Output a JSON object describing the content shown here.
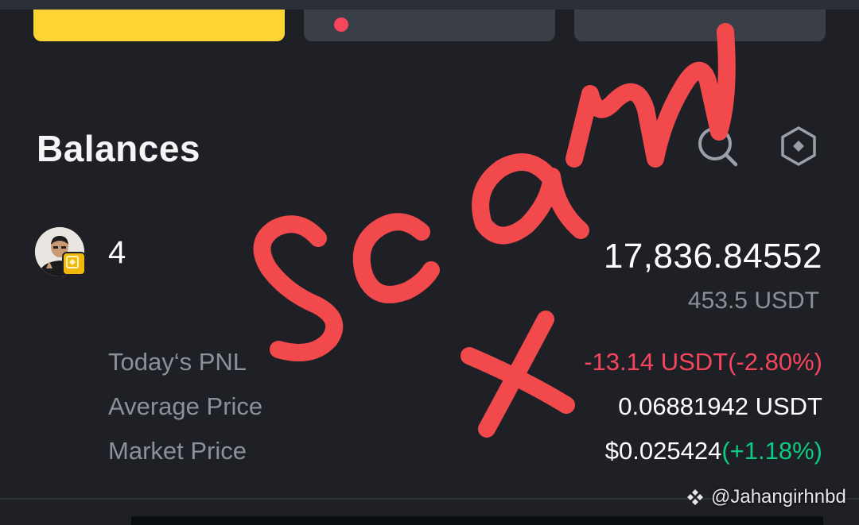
{
  "balances": {
    "title": "Balances"
  },
  "asset": {
    "name": "4",
    "amount": "17,836.84552",
    "value_usdt": "453.5 USDT"
  },
  "details": [
    {
      "label": "Today‘s PNL",
      "value": "-13.14 USDT(-2.80%)"
    },
    {
      "label": "Average Price",
      "value": "0.06881942 USDT"
    },
    {
      "label": "Market Price",
      "value": "$0.025424",
      "change": "(+1.18%)"
    }
  ],
  "annotation": {
    "word": "Scam",
    "mark": "X"
  },
  "watermark": {
    "handle": "@Jahangirhnbd"
  },
  "icons": {
    "search": "search-icon",
    "settings": "settings-hex-icon",
    "brand": "binance-logo-icon"
  },
  "colors": {
    "accent": "#fcd535",
    "negative": "#f6465d",
    "positive": "#0ecb81",
    "annotation": "#f2494d"
  }
}
